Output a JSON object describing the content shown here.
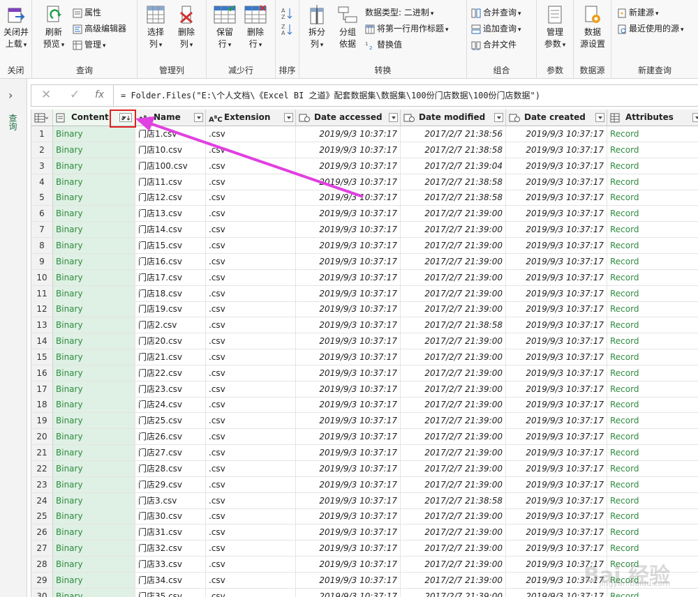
{
  "ribbon": {
    "groups": {
      "close": "关闭",
      "query": "查询",
      "manage_columns": "管理列",
      "reduce_rows": "减少行",
      "sort": "排序",
      "transform": "转换",
      "combine": "组合",
      "parameters": "参数",
      "data_source": "数据源",
      "new_query": "新建查询"
    },
    "close_load": [
      "关闭并",
      "上载"
    ],
    "refresh_preview": [
      "刷新",
      "预览"
    ],
    "properties": "属性",
    "advanced_editor": "高级编辑器",
    "manage": "管理",
    "choose_columns": [
      "选择",
      "列"
    ],
    "remove_columns": [
      "删除",
      "列"
    ],
    "keep_rows": [
      "保留",
      "行"
    ],
    "remove_rows": [
      "删除",
      "行"
    ],
    "split_column": [
      "拆分",
      "列"
    ],
    "group_by": [
      "分组",
      "依据"
    ],
    "data_type": "数据类型: 二进制",
    "first_row_header": "将第一行用作标题",
    "replace_values": "替换值",
    "merge_queries": "合并查询",
    "append_queries": "追加查询",
    "combine_files": "合并文件",
    "manage_params": [
      "管理",
      "参数"
    ],
    "ds_settings": [
      "数据",
      "源设置"
    ],
    "new_source": "新建源",
    "recent_sources": "最近使用的源"
  },
  "left_pane": {
    "label": "查询"
  },
  "formula_bar": {
    "fx": "fx",
    "text": "= Folder.Files(\"E:\\个人文档\\《Excel BI 之道》配套数据集\\数据集\\100份门店数据\\100份门店数据\")"
  },
  "table": {
    "headers": [
      "Content",
      "Name",
      "Extension",
      "Date accessed",
      "Date modified",
      "Date created",
      "Attributes"
    ],
    "rows": [
      [
        "1",
        "Binary",
        "门店1.csv",
        ".csv",
        "2019/9/3 10:37:17",
        "2017/2/7 21:38:56",
        "2019/9/3 10:37:17",
        "Record"
      ],
      [
        "2",
        "Binary",
        "门店10.csv",
        ".csv",
        "2019/9/3 10:37:17",
        "2017/2/7 21:38:58",
        "2019/9/3 10:37:17",
        "Record"
      ],
      [
        "3",
        "Binary",
        "门店100.csv",
        ".csv",
        "2019/9/3 10:37:17",
        "2017/2/7 21:39:04",
        "2019/9/3 10:37:17",
        "Record"
      ],
      [
        "4",
        "Binary",
        "门店11.csv",
        ".csv",
        "2019/9/3 10:37:17",
        "2017/2/7 21:38:58",
        "2019/9/3 10:37:17",
        "Record"
      ],
      [
        "5",
        "Binary",
        "门店12.csv",
        ".csv",
        "2019/9/3 10:37:17",
        "2017/2/7 21:38:58",
        "2019/9/3 10:37:17",
        "Record"
      ],
      [
        "6",
        "Binary",
        "门店13.csv",
        ".csv",
        "2019/9/3 10:37:17",
        "2017/2/7 21:39:00",
        "2019/9/3 10:37:17",
        "Record"
      ],
      [
        "7",
        "Binary",
        "门店14.csv",
        ".csv",
        "2019/9/3 10:37:17",
        "2017/2/7 21:39:00",
        "2019/9/3 10:37:17",
        "Record"
      ],
      [
        "8",
        "Binary",
        "门店15.csv",
        ".csv",
        "2019/9/3 10:37:17",
        "2017/2/7 21:39:00",
        "2019/9/3 10:37:17",
        "Record"
      ],
      [
        "9",
        "Binary",
        "门店16.csv",
        ".csv",
        "2019/9/3 10:37:17",
        "2017/2/7 21:39:00",
        "2019/9/3 10:37:17",
        "Record"
      ],
      [
        "10",
        "Binary",
        "门店17.csv",
        ".csv",
        "2019/9/3 10:37:17",
        "2017/2/7 21:39:00",
        "2019/9/3 10:37:17",
        "Record"
      ],
      [
        "11",
        "Binary",
        "门店18.csv",
        ".csv",
        "2019/9/3 10:37:17",
        "2017/2/7 21:39:00",
        "2019/9/3 10:37:17",
        "Record"
      ],
      [
        "12",
        "Binary",
        "门店19.csv",
        ".csv",
        "2019/9/3 10:37:17",
        "2017/2/7 21:39:00",
        "2019/9/3 10:37:17",
        "Record"
      ],
      [
        "13",
        "Binary",
        "门店2.csv",
        ".csv",
        "2019/9/3 10:37:17",
        "2017/2/7 21:38:58",
        "2019/9/3 10:37:17",
        "Record"
      ],
      [
        "14",
        "Binary",
        "门店20.csv",
        ".csv",
        "2019/9/3 10:37:17",
        "2017/2/7 21:39:00",
        "2019/9/3 10:37:17",
        "Record"
      ],
      [
        "15",
        "Binary",
        "门店21.csv",
        ".csv",
        "2019/9/3 10:37:17",
        "2017/2/7 21:39:00",
        "2019/9/3 10:37:17",
        "Record"
      ],
      [
        "16",
        "Binary",
        "门店22.csv",
        ".csv",
        "2019/9/3 10:37:17",
        "2017/2/7 21:39:00",
        "2019/9/3 10:37:17",
        "Record"
      ],
      [
        "17",
        "Binary",
        "门店23.csv",
        ".csv",
        "2019/9/3 10:37:17",
        "2017/2/7 21:39:00",
        "2019/9/3 10:37:17",
        "Record"
      ],
      [
        "18",
        "Binary",
        "门店24.csv",
        ".csv",
        "2019/9/3 10:37:17",
        "2017/2/7 21:39:00",
        "2019/9/3 10:37:17",
        "Record"
      ],
      [
        "19",
        "Binary",
        "门店25.csv",
        ".csv",
        "2019/9/3 10:37:17",
        "2017/2/7 21:39:00",
        "2019/9/3 10:37:17",
        "Record"
      ],
      [
        "20",
        "Binary",
        "门店26.csv",
        ".csv",
        "2019/9/3 10:37:17",
        "2017/2/7 21:39:00",
        "2019/9/3 10:37:17",
        "Record"
      ],
      [
        "21",
        "Binary",
        "门店27.csv",
        ".csv",
        "2019/9/3 10:37:17",
        "2017/2/7 21:39:00",
        "2019/9/3 10:37:17",
        "Record"
      ],
      [
        "22",
        "Binary",
        "门店28.csv",
        ".csv",
        "2019/9/3 10:37:17",
        "2017/2/7 21:39:00",
        "2019/9/3 10:37:17",
        "Record"
      ],
      [
        "23",
        "Binary",
        "门店29.csv",
        ".csv",
        "2019/9/3 10:37:17",
        "2017/2/7 21:39:00",
        "2019/9/3 10:37:17",
        "Record"
      ],
      [
        "24",
        "Binary",
        "门店3.csv",
        ".csv",
        "2019/9/3 10:37:17",
        "2017/2/7 21:38:58",
        "2019/9/3 10:37:17",
        "Record"
      ],
      [
        "25",
        "Binary",
        "门店30.csv",
        ".csv",
        "2019/9/3 10:37:17",
        "2017/2/7 21:39:00",
        "2019/9/3 10:37:17",
        "Record"
      ],
      [
        "26",
        "Binary",
        "门店31.csv",
        ".csv",
        "2019/9/3 10:37:17",
        "2017/2/7 21:39:00",
        "2019/9/3 10:37:17",
        "Record"
      ],
      [
        "27",
        "Binary",
        "门店32.csv",
        ".csv",
        "2019/9/3 10:37:17",
        "2017/2/7 21:39:00",
        "2019/9/3 10:37:17",
        "Record"
      ],
      [
        "28",
        "Binary",
        "门店33.csv",
        ".csv",
        "2019/9/3 10:37:17",
        "2017/2/7 21:39:00",
        "2019/9/3 10:37:17",
        "Record"
      ],
      [
        "29",
        "Binary",
        "门店34.csv",
        ".csv",
        "2019/9/3 10:37:17",
        "2017/2/7 21:39:00",
        "2019/9/3 10:37:17",
        "Record"
      ],
      [
        "30",
        "Binary",
        "门店35.csv",
        ".csv",
        "2019/9/3 10:37:17",
        "2017/2/7 21:39:00",
        "2019/9/3 10:37:17",
        "Record"
      ]
    ]
  },
  "watermark": {
    "brand": "Bai 经验",
    "url": "jingyan.baidu.com"
  },
  "colors": {
    "accent_green": "#217346",
    "content_bg": "#dff0e4",
    "annotation_red": "#e02020",
    "arrow_magenta": "#e040e0"
  }
}
